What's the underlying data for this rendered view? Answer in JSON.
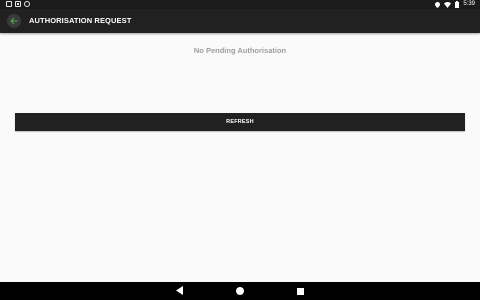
{
  "status_bar": {
    "time": "5:39",
    "icons": [
      "notification-icon",
      "download-icon",
      "sync-icon",
      "location-icon",
      "wifi-icon",
      "battery-icon"
    ]
  },
  "app_bar": {
    "title": "AUTHORISATION REQUEST",
    "back_icon": "arrow-left-icon",
    "accent_color": "#4caf50"
  },
  "content": {
    "empty_message": "No Pending Authorisation",
    "refresh_label": "REFRESH"
  },
  "nav_bar": {
    "buttons": [
      "back-triangle-icon",
      "home-circle-icon",
      "recents-square-icon"
    ]
  }
}
